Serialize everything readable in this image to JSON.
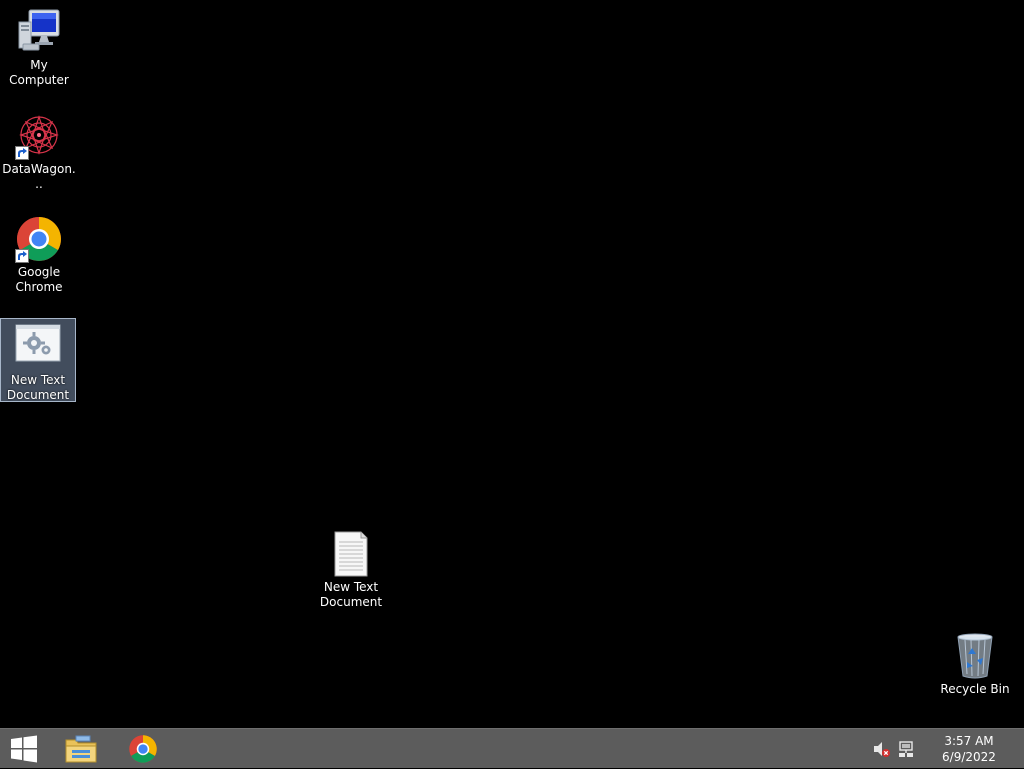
{
  "desktop": {
    "icons": [
      {
        "label": "My Computer",
        "icon": "computer-icon"
      },
      {
        "label": "DataWagon...",
        "icon": "datawagon-icon"
      },
      {
        "label": "Google Chrome",
        "icon": "chrome-icon"
      },
      {
        "label": "New Text Document",
        "icon": "settings-document-icon"
      },
      {
        "label": "New Text Document",
        "icon": "text-file-icon"
      },
      {
        "label": "Recycle Bin",
        "icon": "recycle-bin-icon"
      }
    ]
  },
  "taskbar": {
    "start_icon": "windows-start-icon",
    "pinned": [
      {
        "name": "File Explorer",
        "icon": "file-explorer-icon"
      },
      {
        "name": "Google Chrome",
        "icon": "chrome-icon"
      }
    ],
    "tray": {
      "volume_icon": "volume-muted-icon",
      "network_icon": "network-icon"
    },
    "clock": {
      "time": "3:57 AM",
      "date": "6/9/2022"
    }
  },
  "colors": {
    "desktop_bg": "#000000",
    "taskbar_bg": "#5c5c5c",
    "selection": "#7889a8"
  }
}
